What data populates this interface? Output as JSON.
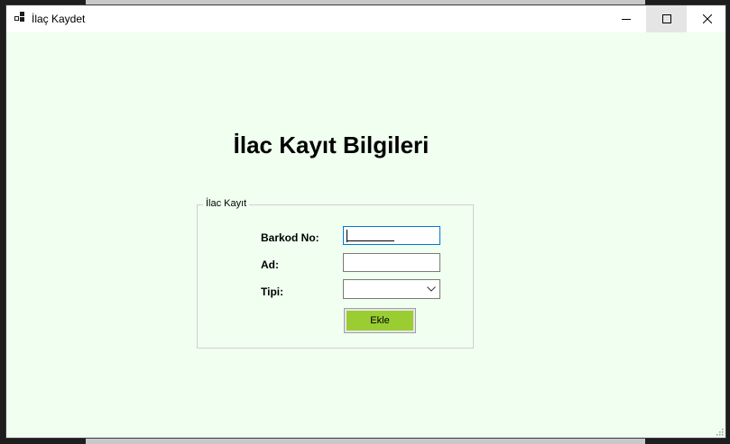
{
  "window": {
    "title": "İlaç Kaydet",
    "icon": "windows-forms-app-icon"
  },
  "titlebar_buttons": {
    "minimize": "minimize-icon",
    "maximize": "maximize-icon",
    "close": "close-icon"
  },
  "form": {
    "heading": "İlac Kayıt Bilgileri",
    "group_title": "İlac Kayıt",
    "labels": {
      "barcode": "Barkod No:",
      "name": "Ad:",
      "type": "Tipi:"
    },
    "fields": {
      "barcode_value": "",
      "name_value": "",
      "type_selected": ""
    },
    "submit_label": "Ekle"
  },
  "colors": {
    "background": "#f0fff0",
    "button": "#9acd32",
    "focus_border": "#0078d7"
  }
}
